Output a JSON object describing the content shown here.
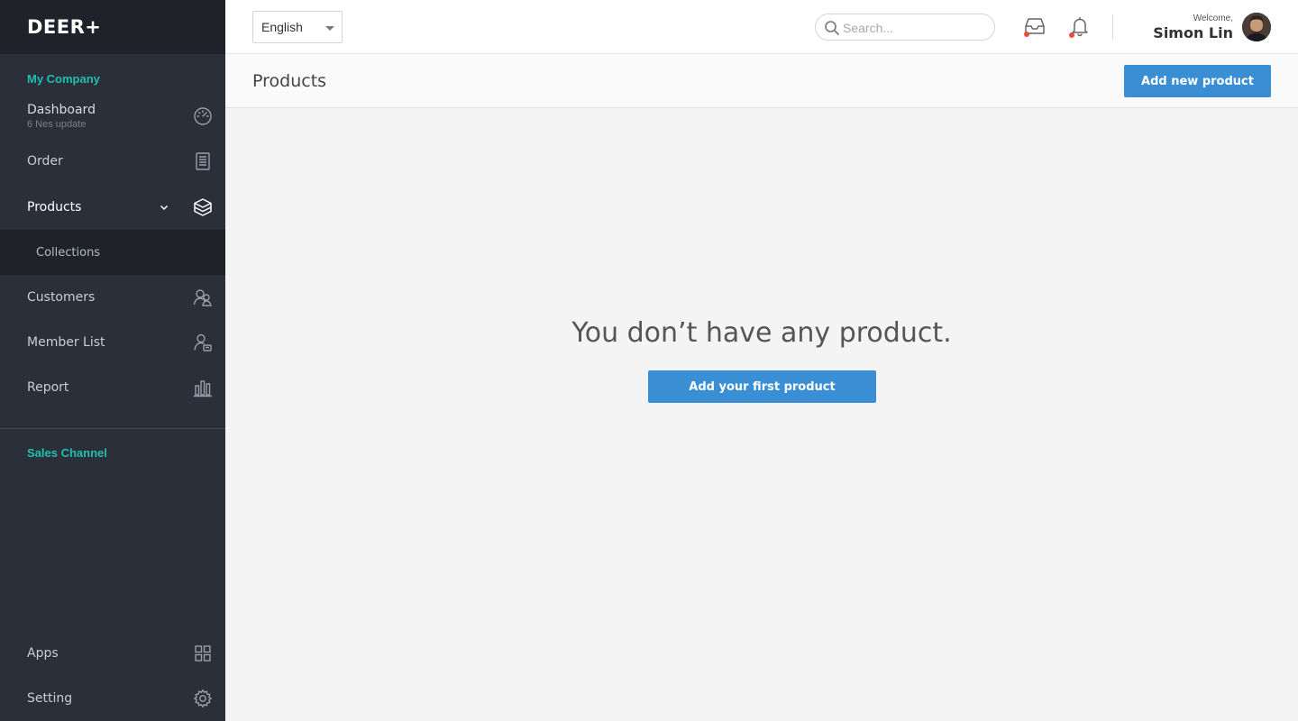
{
  "brand": {
    "name": "DEER+"
  },
  "sidebar": {
    "sections": {
      "company": "My Company",
      "sales": "Sales Channel"
    },
    "items": [
      {
        "label": "Dashboard",
        "sublabel": "6 Nes update",
        "icon": "speedometer-icon"
      },
      {
        "label": "Order",
        "icon": "document-icon"
      },
      {
        "label": "Products",
        "icon": "box-icon",
        "expanded": true
      },
      {
        "label": "Customers",
        "icon": "users-icon"
      },
      {
        "label": "Member List",
        "icon": "member-card-icon"
      },
      {
        "label": "Report",
        "icon": "bar-chart-icon"
      },
      {
        "label": "Apps",
        "icon": "grid-icon"
      },
      {
        "label": "Setting",
        "icon": "gear-icon"
      }
    ],
    "subitems": [
      {
        "label": "Collections"
      }
    ]
  },
  "topbar": {
    "language": "English",
    "search_placeholder": "Search...",
    "welcome_label": "Welcome,",
    "user_name": "Simon Lin"
  },
  "page": {
    "title": "Products",
    "add_button": "Add new product",
    "empty_message": "You don’t have any product.",
    "empty_button": "Add your first product"
  },
  "colors": {
    "sidebar_bg": "#2b2f3a",
    "brand_bg": "#1f2229",
    "section_accent": "#1fc0b0",
    "primary_button": "#3a8fd4",
    "notification_dot": "#e74c3c"
  }
}
